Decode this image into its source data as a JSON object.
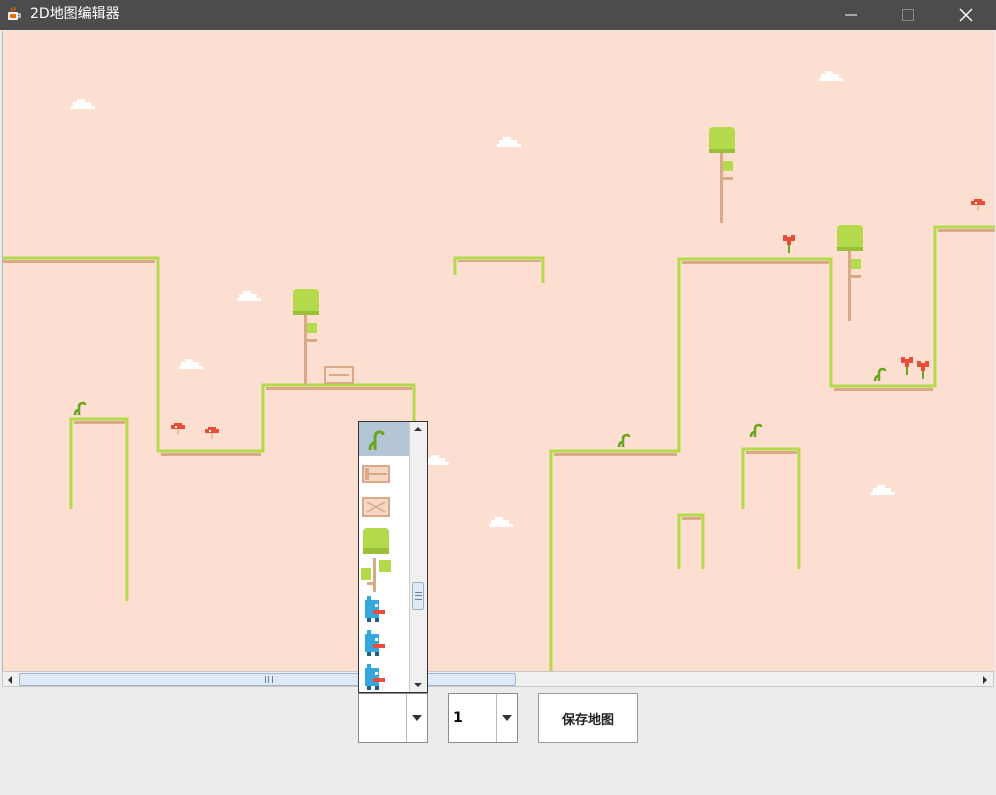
{
  "window": {
    "title": "2D地图编辑器",
    "colors": {
      "titlebar": "#4c4c4c",
      "sky": "#fcdfd0",
      "grass": "#b4d94a",
      "dirt": "#d9a988",
      "accent_red": "#e84d3a",
      "player_blue": "#35a7df"
    }
  },
  "icons": {
    "app": "java-icon",
    "minimize": "minimize-icon",
    "maximize": "maximize-icon",
    "close": "close-icon"
  },
  "tile_palette": {
    "items": [
      "sprout-tile",
      "crate-tile",
      "broken-crate-tile",
      "tree-top-tile",
      "branch-tile",
      "player-tile",
      "player-tile",
      "player-tile"
    ],
    "selected_index": 0
  },
  "controls": {
    "layer_value": "1",
    "save_label": "保存地图"
  },
  "scroll": {
    "horizontal_fraction": 0.5,
    "vertical_fraction": 0.6
  }
}
